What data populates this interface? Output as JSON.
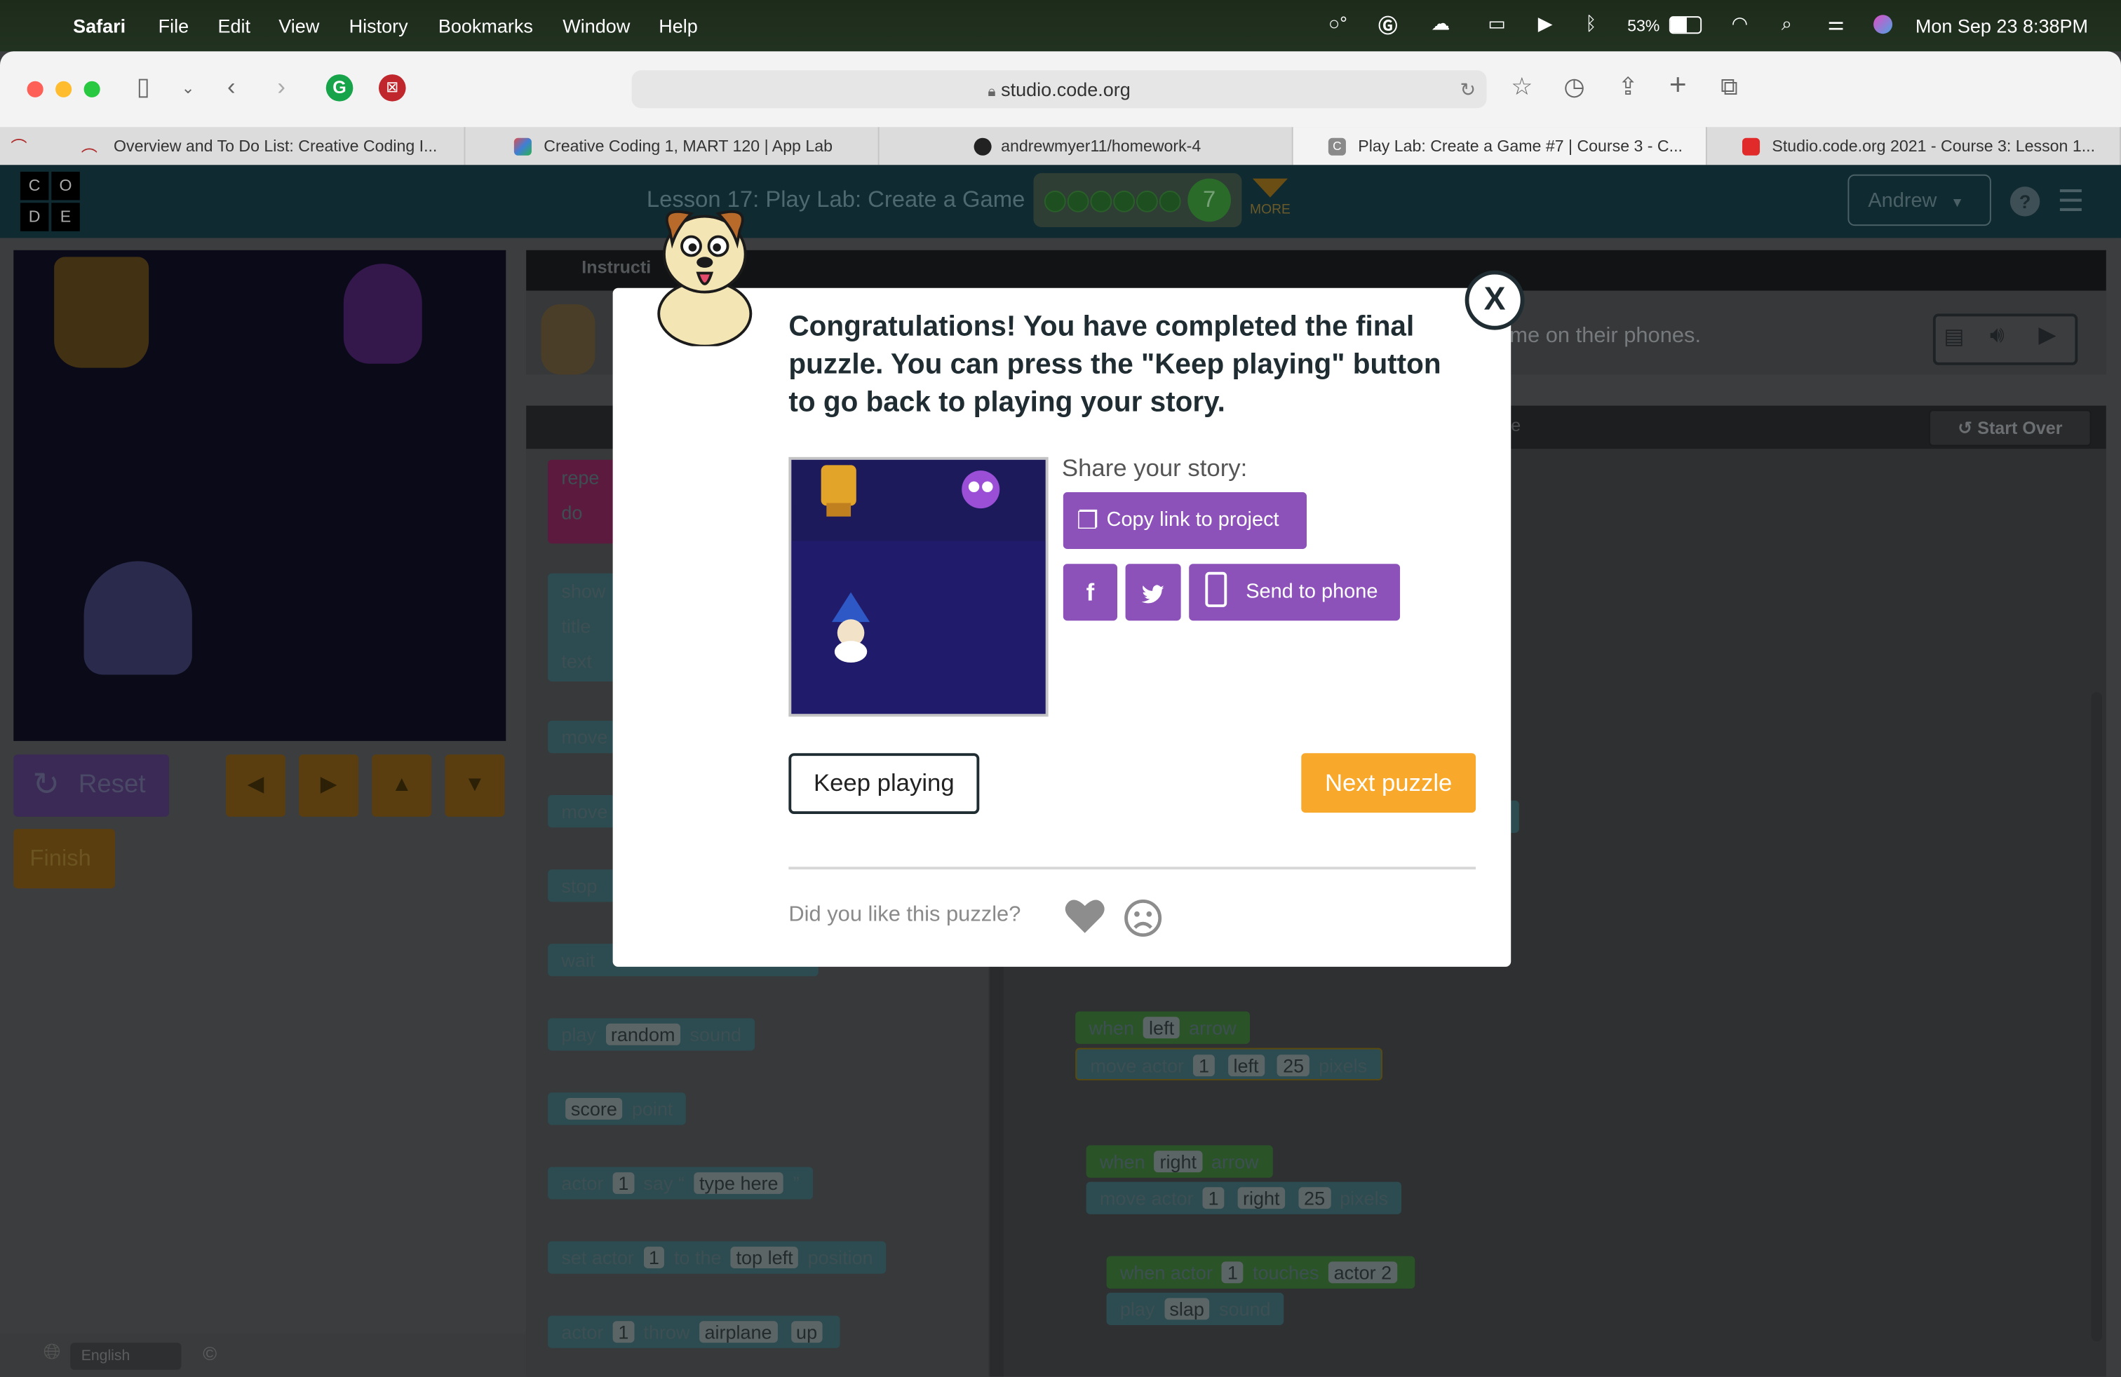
{
  "menubar": {
    "app": "Safari",
    "items": [
      "File",
      "Edit",
      "View",
      "History",
      "Bookmarks",
      "Window",
      "Help"
    ],
    "battery": "53%",
    "datetime": "Mon Sep 23  8:38PM"
  },
  "browser": {
    "url": "studio.code.org",
    "tabs": [
      {
        "label": "Overview and To Do List: Creative Coding I...",
        "color": "#b02a2a"
      },
      {
        "label": "Creative Coding 1, MART 120 | App Lab",
        "color": "#3f7fd6"
      },
      {
        "label": "andrewmyer11/homework-4",
        "color": "#222222"
      },
      {
        "label": "Play Lab: Create a Game #7 | Course 3 - C...",
        "color": "#8a8a8a"
      },
      {
        "label": "Studio.code.org 2021 - Course 3: Lesson 1...",
        "color": "#e12b2b"
      }
    ]
  },
  "topbar": {
    "logo_letters": [
      "C",
      "O",
      "D",
      "E"
    ],
    "lesson_title": "Lesson 17: Play Lab: Create a Game",
    "puzzle_number": "7",
    "more_label": "MORE",
    "user": "Andrew",
    "help": "?"
  },
  "game": {
    "reset_label": "Reset",
    "finish_label": "Finish",
    "arrows": [
      "◀",
      "▶",
      "▲",
      "▼"
    ]
  },
  "instructions": {
    "tab_label": "Instructi",
    "text_fragment": "me on their phones.",
    "start_over": "Start Over",
    "fragment_e": "e"
  },
  "toolbox": {
    "blocks": [
      {
        "text": "repe",
        "sub": "do"
      },
      {
        "text": "show",
        "sub1": "title",
        "sub2": "text"
      },
      {
        "text": "move"
      },
      {
        "text": "move"
      },
      {
        "text": "stop"
      },
      {
        "text": "wait"
      },
      {
        "pre": "play",
        "slot": "random",
        "post": "sound"
      },
      {
        "slot": "score",
        "post": "point"
      },
      {
        "pre": "actor",
        "slot": "1",
        "mid": "say",
        "slot2": "type here"
      },
      {
        "pre": "set actor",
        "slot": "1",
        "mid": "to the",
        "slot2": "top left",
        "post": "position"
      },
      {
        "pre": "actor",
        "slot": "1",
        "mid": "throw",
        "slot2": "airplane",
        "slot3": "up"
      }
    ]
  },
  "workspace": {
    "groups": [
      {
        "when": "when",
        "dir": "left",
        "arrow": "arrow",
        "move": "move actor",
        "actor": "1",
        "dir2": "left",
        "px": "25",
        "pixels": "pixels"
      },
      {
        "when": "when",
        "dir": "right",
        "arrow": "arrow",
        "move": "move actor",
        "actor": "1",
        "dir2": "right",
        "px": "25",
        "pixels": "pixels"
      },
      {
        "when": "when actor",
        "actor": "1",
        "touches": "touches",
        "target": "actor 2",
        "play": "play",
        "sound": "slap",
        "sound_label": "sound"
      }
    ]
  },
  "footer": {
    "language": "English",
    "copyright": "©"
  },
  "modal": {
    "close": "X",
    "message": "Congratulations! You have completed the final puzzle. You can press the \"Keep playing\" button to go back to playing your story.",
    "share_label": "Share your story:",
    "copy_link": "Copy link to project",
    "send_phone": "Send to phone",
    "keep_playing": "Keep playing",
    "next_puzzle": "Next puzzle",
    "feedback_question": "Did you like this puzzle?"
  }
}
